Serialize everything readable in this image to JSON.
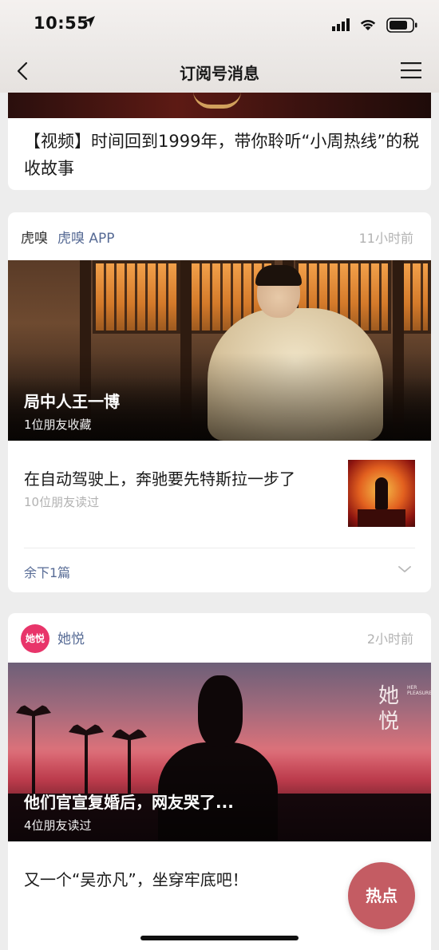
{
  "status_bar": {
    "time": "10:55"
  },
  "nav": {
    "title": "订阅号消息"
  },
  "card1": {
    "text": "【视频】时间回到1999年，带你聆听“小周热线”的税收故事"
  },
  "card2": {
    "logo_text": "虎嗅",
    "account": "虎嗅 APP",
    "time": "11小时前",
    "hero_title": "局中人王一博",
    "hero_sub": "1位朋友收藏",
    "item_title": "在自动驾驶上，奔驰要先特斯拉一步了",
    "item_reads": "10位朋友读过",
    "more": "余下1篇"
  },
  "card3": {
    "logo_text": "她悦",
    "account": "她悦",
    "time": "2小时前",
    "brand_mark": "她悦",
    "brand_tiny": "HER PLEASURE",
    "hero_title": "他们官宣复婚后，网友哭了...",
    "hero_sub": "4位朋友读过",
    "item_title": "又一个“吴亦凡”，坐穿牢底吧！"
  },
  "hot_button": "热点",
  "colors": {
    "link": "#576b95",
    "muted": "#b2b2b2",
    "hot": "#c45c63",
    "tayue_brand": "#e8356a"
  }
}
